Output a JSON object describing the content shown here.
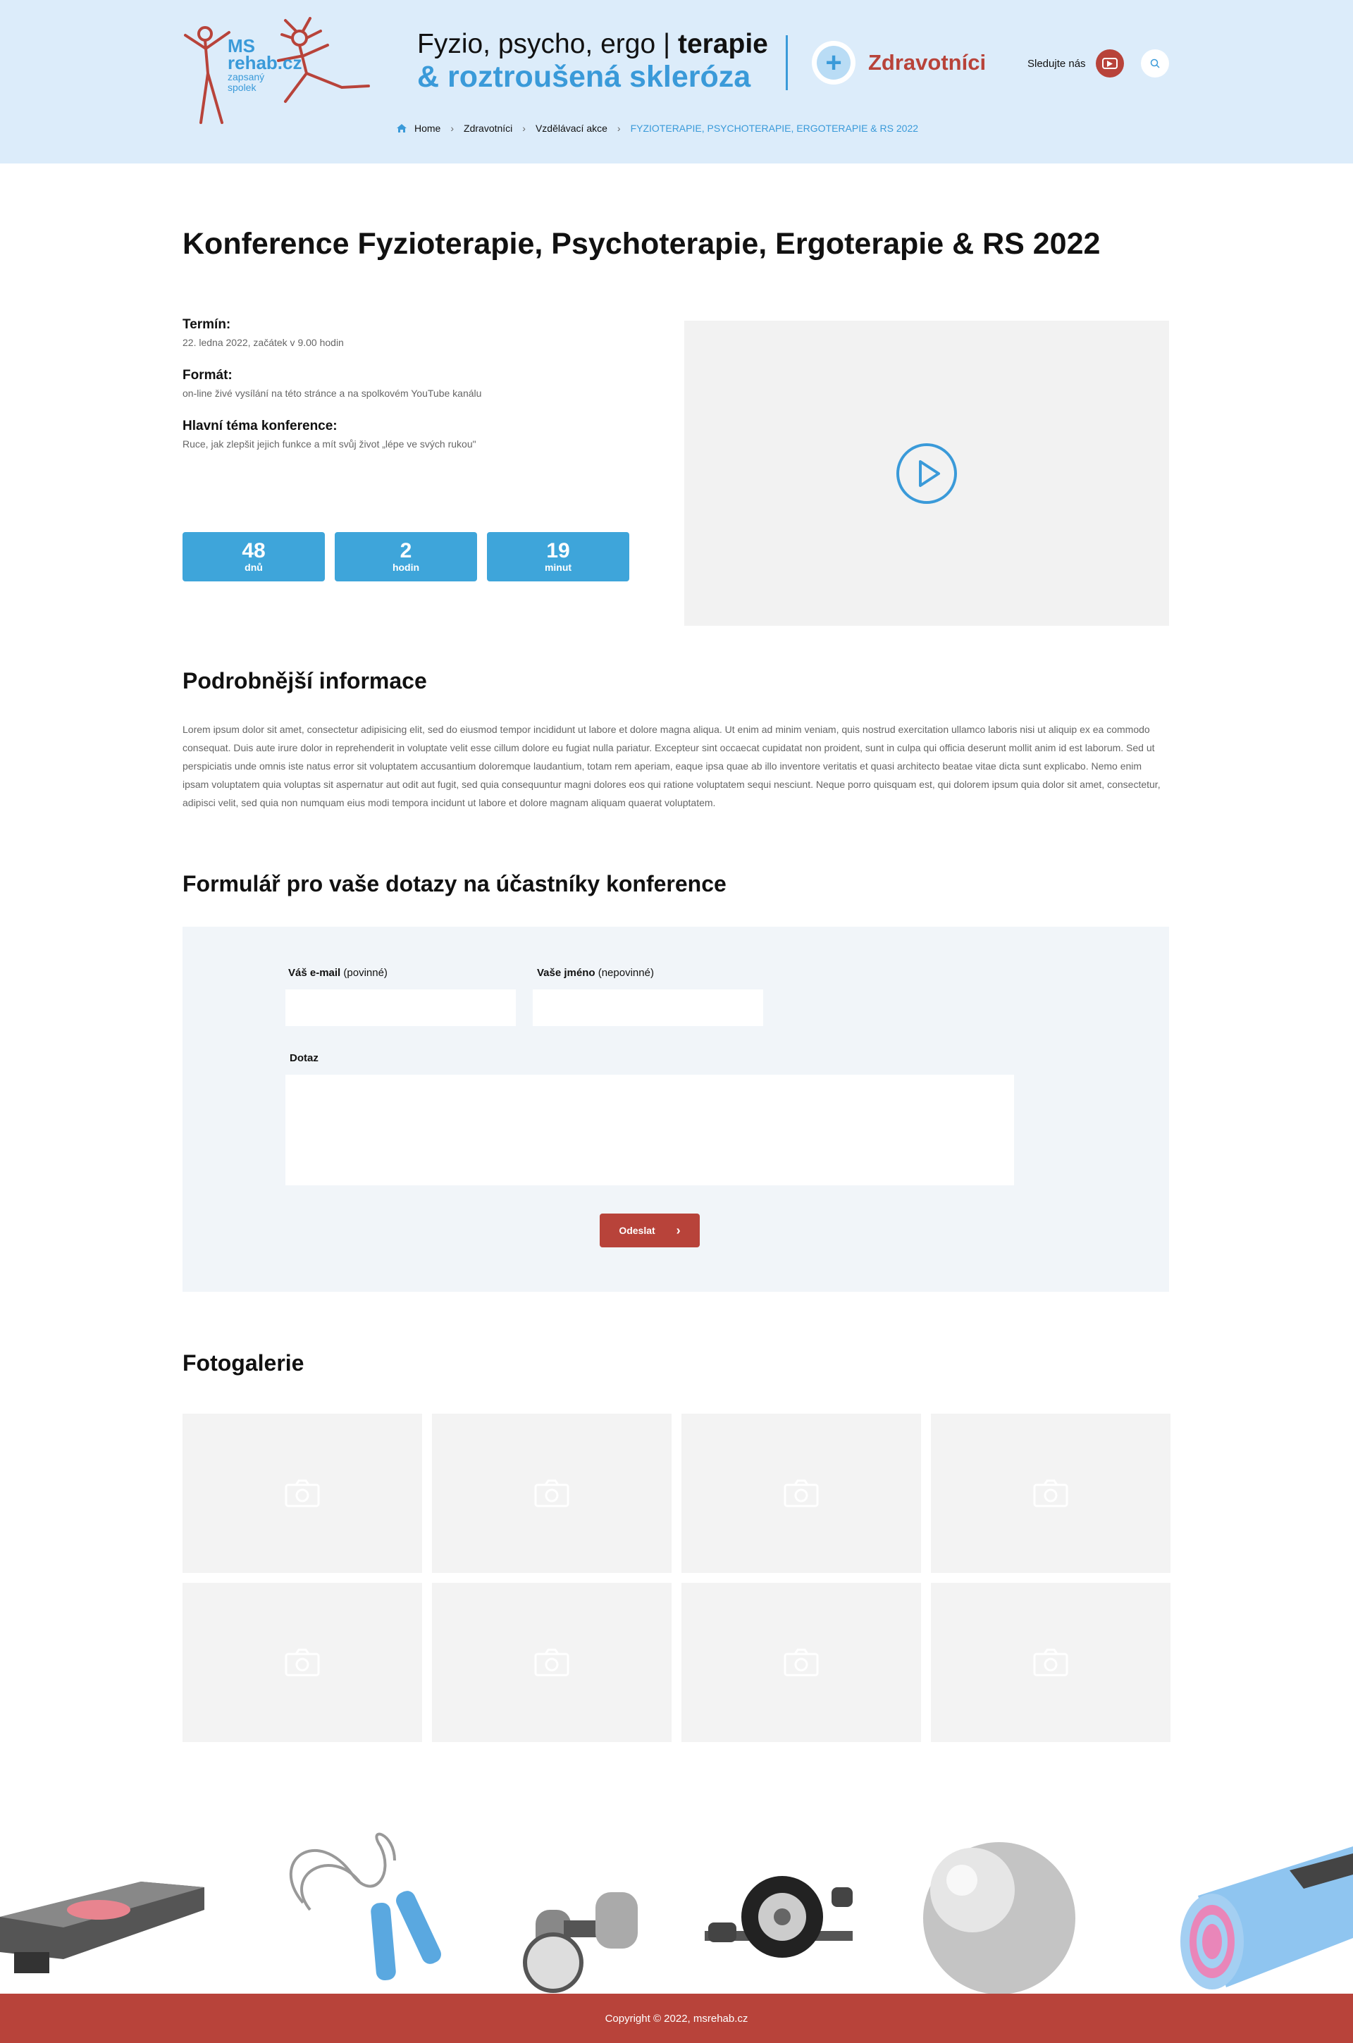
{
  "header": {
    "logo": {
      "line1": "MS",
      "line2": "rehab.cz",
      "line3": "zapsaný",
      "line4": "spolek"
    },
    "tagline": {
      "part1": "Fyzio, psycho, ergo |",
      "part1_bold": "terapie",
      "part2": "& roztroušená skleróza"
    },
    "zdravotnici": "Zdravotníci",
    "follow_label": "Sledujte nás"
  },
  "breadcrumb": [
    "Home",
    "Zdravotníci",
    "Vzdělávací akce",
    "FYZIOTERAPIE, PSYCHOTERAPIE, ERGOTERAPIE & RS 2022"
  ],
  "page_title": "Konference Fyzioterapie, Psychoterapie, Ergoterapie & RS 2022",
  "info": {
    "termin_label": "Termín:",
    "termin_value": "22. ledna 2022, začátek v 9.00 hodin",
    "format_label": "Formát:",
    "format_value": "on-line živé vysílání na této stránce a na spolkovém YouTube kanálu",
    "tema_label": "Hlavní téma konference:",
    "tema_value": "Ruce, jak zlepšit jejich funkce a mít svůj život „lépe ve svých rukou\""
  },
  "countdown": [
    {
      "num": "48",
      "unit": "dnů"
    },
    {
      "num": "2",
      "unit": "hodin"
    },
    {
      "num": "19",
      "unit": "minut"
    }
  ],
  "details": {
    "heading": "Podrobnější informace",
    "text": "Lorem ipsum dolor sit amet, consectetur adipisicing elit, sed do eiusmod tempor incididunt ut labore et dolore magna aliqua. Ut enim ad minim veniam, quis nostrud exercitation ullamco laboris nisi ut aliquip ex ea commodo consequat. Duis aute irure dolor in reprehenderit in voluptate velit esse cillum dolore eu fugiat nulla pariatur. Excepteur sint occaecat cupidatat non proident, sunt in culpa qui officia deserunt mollit anim id est laborum. Sed ut perspiciatis unde omnis iste natus error sit voluptatem accusantium doloremque laudantium, totam rem aperiam, eaque ipsa quae ab illo inventore veritatis et quasi architecto beatae vitae dicta sunt explicabo. Nemo enim ipsam voluptatem quia voluptas sit aspernatur aut odit aut fugit, sed quia consequuntur magni dolores eos qui ratione voluptatem sequi nesciunt. Neque porro quisquam est, qui dolorem ipsum quia dolor sit amet, consectetur, adipisci velit, sed quia non numquam eius modi tempora incidunt ut labore et dolore magnam aliquam quaerat voluptatem."
  },
  "form": {
    "heading": "Formulář pro vaše dotazy na účastníky konference",
    "email_label": "Váš e-mail",
    "email_note": "(povinné)",
    "email_value": "",
    "name_label": "Vaše jméno",
    "name_note": "(nepovinné)",
    "name_value": "",
    "question_label": "Dotaz",
    "question_value": "",
    "submit_label": "Odeslat"
  },
  "gallery": {
    "heading": "Fotogalerie",
    "count": 8
  },
  "footer": {
    "copyright": "Copyright © 2022, msrehab.cz"
  },
  "colors": {
    "accent_blue": "#3a9ad9",
    "brand_red": "#b8433a",
    "header_bg": "#dcecfa",
    "countdown_blue": "#3ea5da"
  }
}
